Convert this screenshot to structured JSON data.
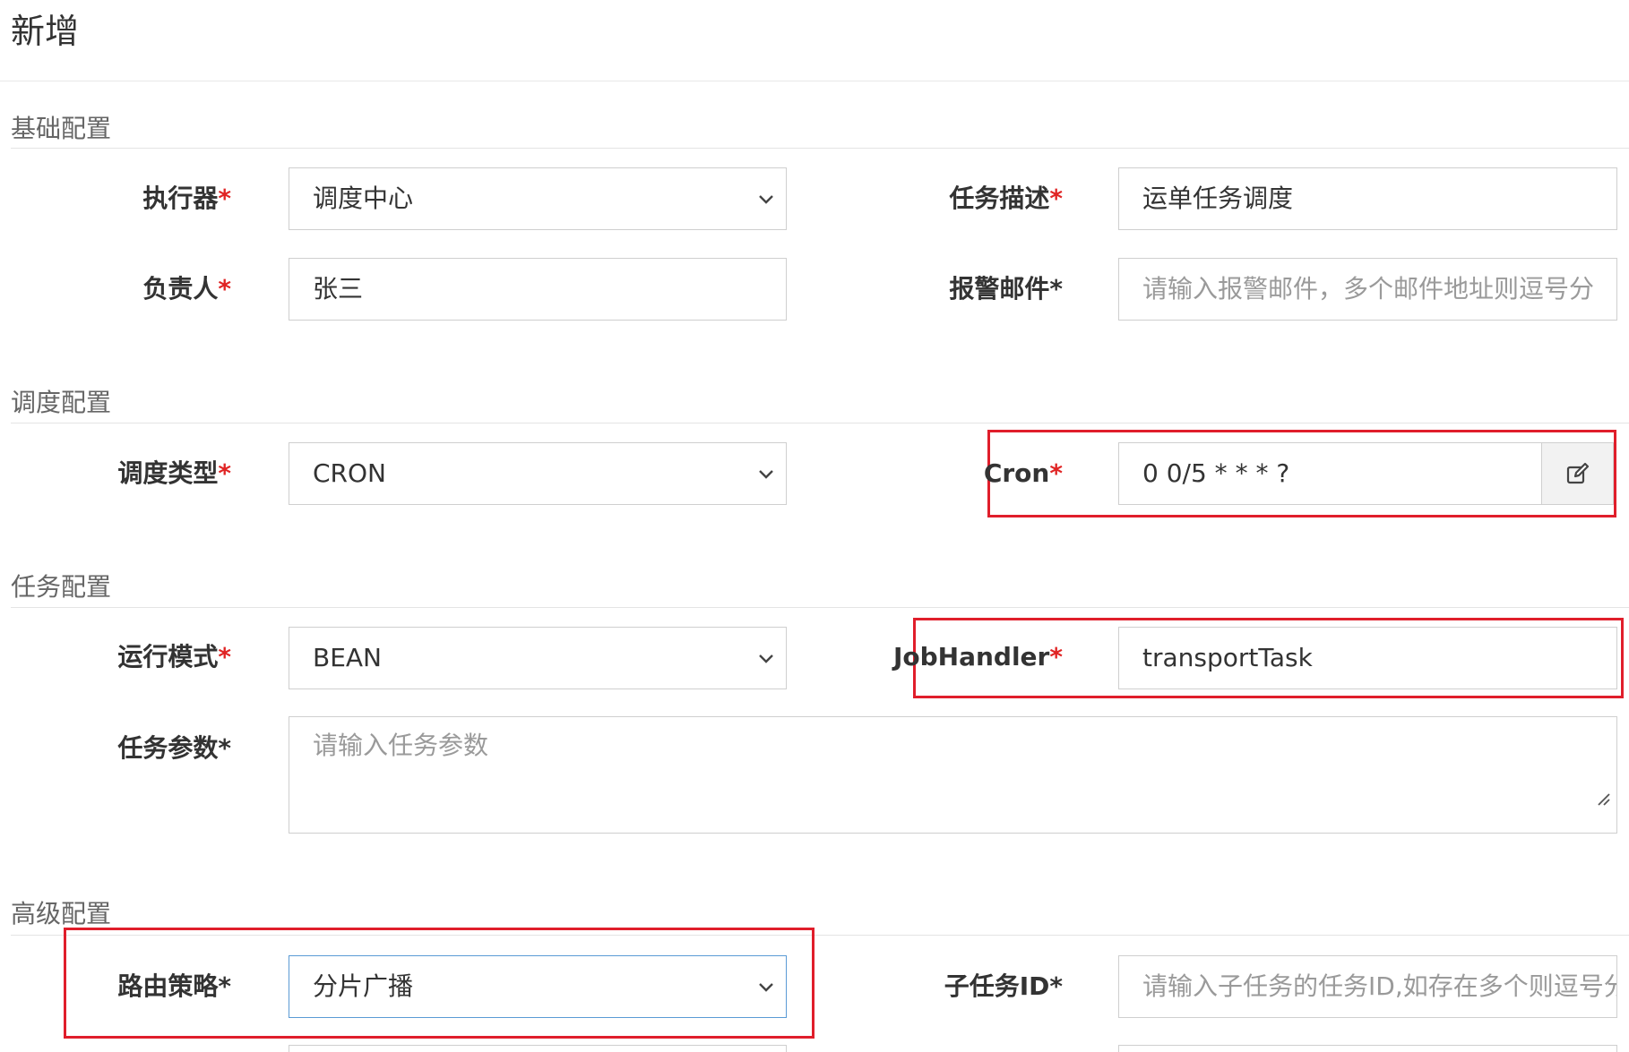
{
  "page": {
    "title": "新增"
  },
  "sections": {
    "basic": "基础配置",
    "schedule": "调度配置",
    "task": "任务配置",
    "advanced": "高级配置"
  },
  "fields": {
    "executor": {
      "label": "执行器",
      "value": "调度中心"
    },
    "job_desc": {
      "label": "任务描述",
      "value": "运单任务调度"
    },
    "owner": {
      "label": "负责人",
      "value": "张三"
    },
    "alarm_email": {
      "label": "报警邮件*",
      "placeholder": "请输入报警邮件，多个邮件地址则逗号分"
    },
    "schedule_type": {
      "label": "调度类型",
      "value": "CRON"
    },
    "cron": {
      "label": "Cron",
      "value": "0 0/5 * * * ?"
    },
    "run_mode": {
      "label": "运行模式",
      "value": "BEAN"
    },
    "job_handler": {
      "label": "JobHandler",
      "value": "transportTask"
    },
    "job_param": {
      "label": "任务参数*",
      "placeholder": "请输入任务参数"
    },
    "route_strategy": {
      "label": "路由策略*",
      "value": "分片广播"
    },
    "child_job_id": {
      "label": "子任务ID*",
      "placeholder": "请输入子任务的任务ID,如存在多个则逗号分"
    }
  },
  "marks": {
    "required": "*"
  },
  "icons": {
    "dropdown": "chevron-down-icon",
    "cron_edit": "edit-icon"
  },
  "colors": {
    "required": "#e02424",
    "highlight": "#e01e2b",
    "focus_border": "#5a9bd5"
  }
}
